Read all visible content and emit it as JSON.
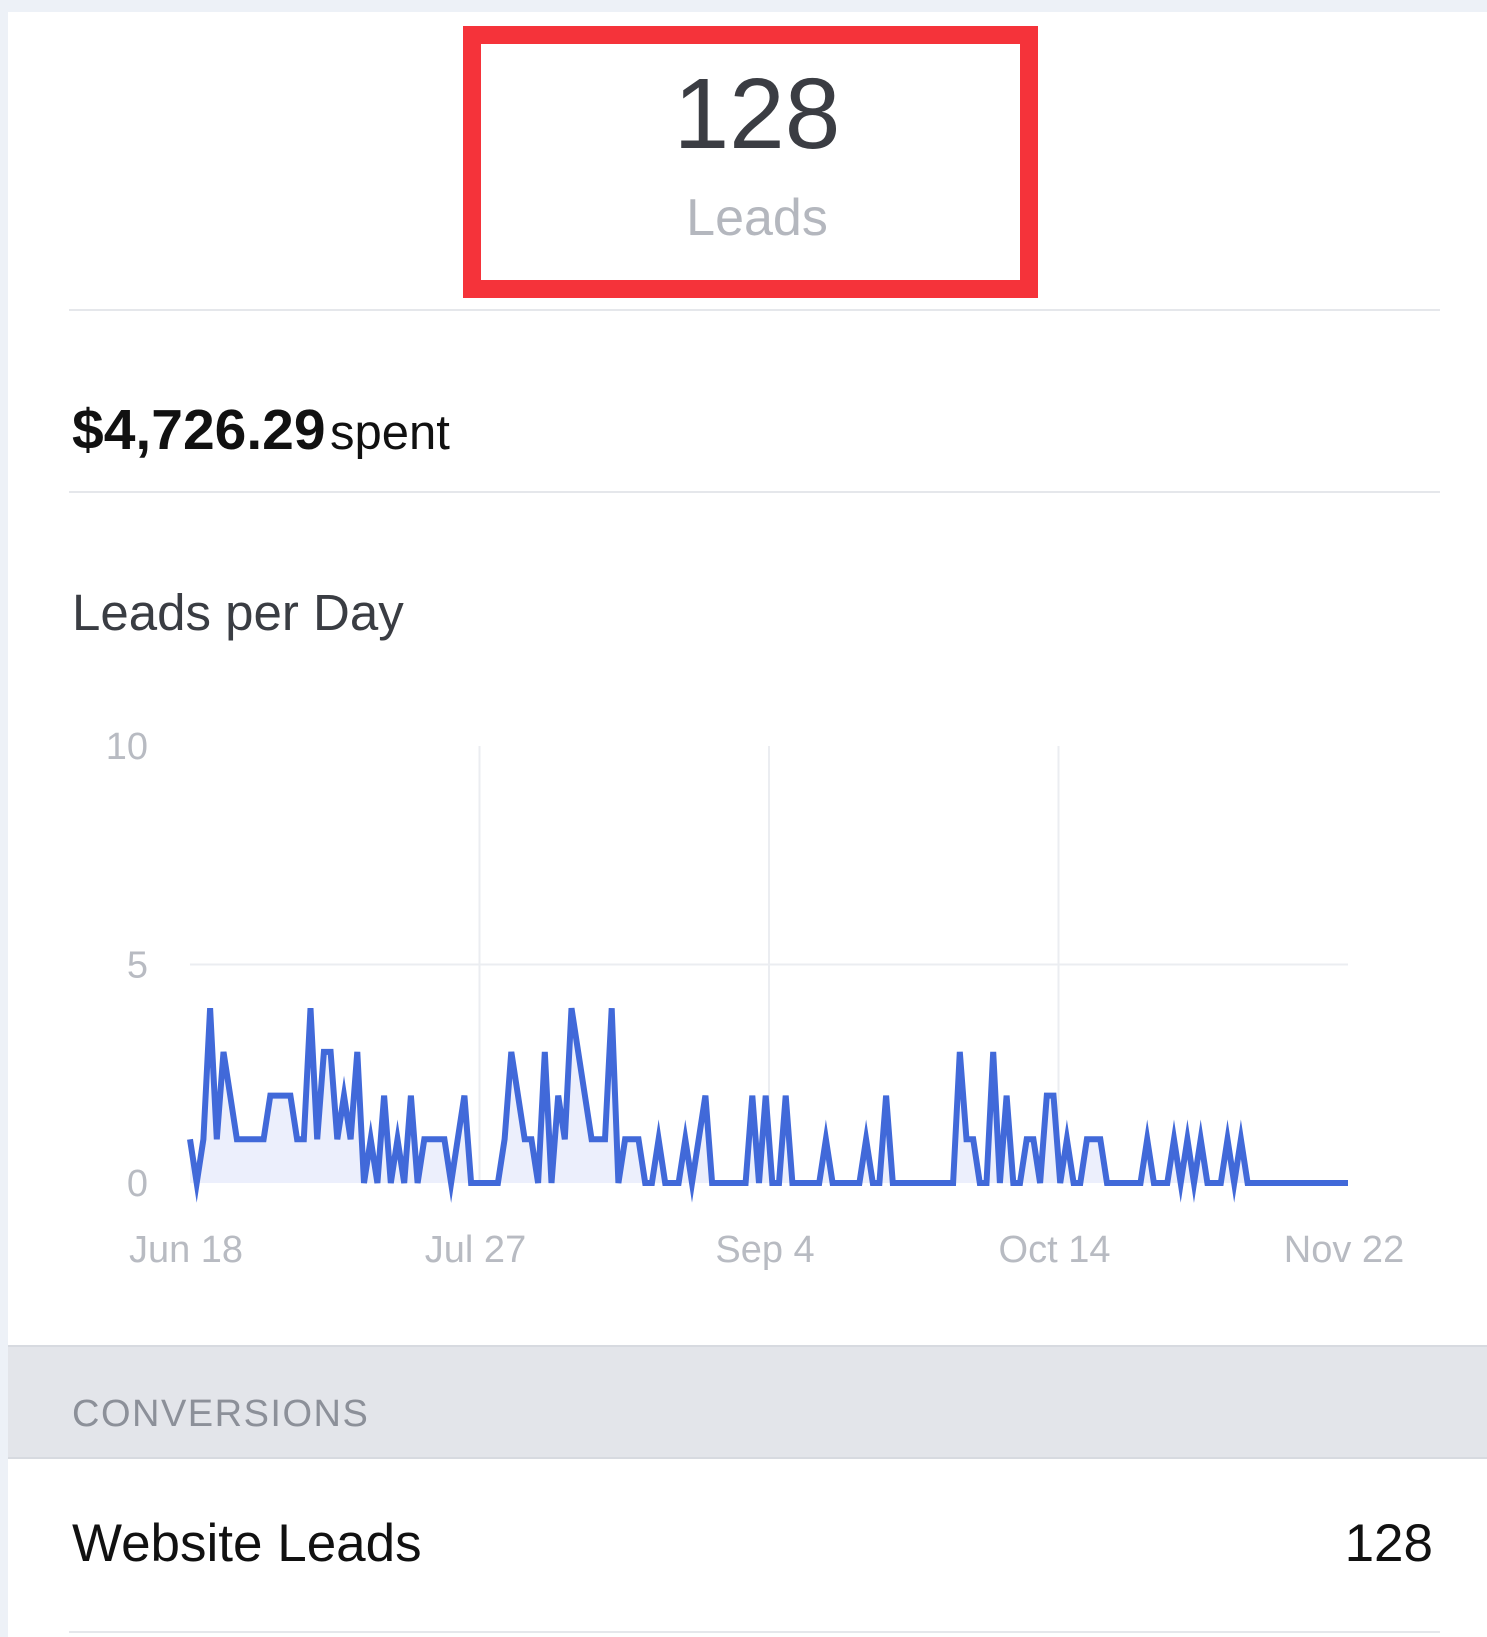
{
  "summary": {
    "count": "128",
    "label": "Leads"
  },
  "spend": {
    "amount": "$4,726.29",
    "suffix": "spent"
  },
  "chart_title": "Leads per Day",
  "chart_data": {
    "type": "area",
    "title": "",
    "xlabel": "",
    "ylabel": "",
    "ylim": [
      0,
      10
    ],
    "y_ticks": [
      "10",
      "5",
      "0"
    ],
    "x_ticks": [
      "Jun 18",
      "Jul 27",
      "Sep 4",
      "Oct 14",
      "Nov 22"
    ],
    "grid": true,
    "line_color": "#4169d9",
    "fill_color": "#eceffc",
    "series": [
      {
        "values": [
          1,
          0,
          1,
          4,
          1,
          3,
          2,
          1,
          1,
          1,
          1,
          1,
          2,
          2,
          2,
          2,
          1,
          1,
          4,
          1,
          3,
          3,
          1,
          2,
          1,
          3,
          0,
          1,
          0,
          2,
          0,
          1,
          0,
          2,
          0,
          1,
          1,
          1,
          1,
          0,
          1,
          2,
          0,
          0,
          0,
          0,
          0,
          1,
          3,
          2,
          1,
          1,
          0,
          3,
          0,
          2,
          1,
          4,
          3,
          2,
          1,
          1,
          1,
          4,
          0,
          1,
          1,
          1,
          0,
          0,
          1,
          0,
          0,
          0,
          1,
          0,
          1,
          2,
          0,
          0,
          0,
          0,
          0,
          0,
          2,
          0,
          2,
          0,
          0,
          2,
          0,
          0,
          0,
          0,
          0,
          1,
          0,
          0,
          0,
          0,
          0,
          1,
          0,
          0,
          2,
          0,
          0,
          0,
          0,
          0,
          0,
          0,
          0,
          0,
          0,
          3,
          1,
          1,
          0,
          0,
          3,
          0,
          2,
          0,
          0,
          1,
          1,
          0,
          2,
          2,
          0,
          1,
          0,
          0,
          1,
          1,
          1,
          0,
          0,
          0,
          0,
          0,
          0,
          1,
          0,
          0,
          0,
          1,
          0,
          1,
          0,
          1,
          0,
          0,
          0,
          1,
          0,
          1,
          0,
          0,
          0,
          0,
          0,
          0,
          0,
          0,
          0,
          0,
          0,
          0,
          0,
          0,
          0,
          0
        ]
      }
    ]
  },
  "section": {
    "label": "CONVERSIONS"
  },
  "conversion_row": {
    "label": "Website Leads",
    "value": "128"
  }
}
